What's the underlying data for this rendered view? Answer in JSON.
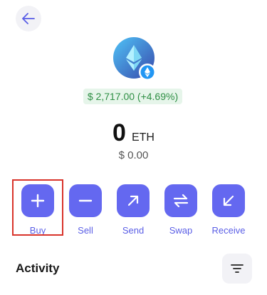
{
  "header": {
    "back_icon": "arrow-left-icon"
  },
  "token": {
    "logo_icon": "ethereum-icon",
    "badge_icon": "network-badge-icon",
    "price_change": "$ 2,717.00 (+4.69%)",
    "balance_amount": "0",
    "balance_symbol": "ETH",
    "fiat_value": "$ 0.00"
  },
  "actions": [
    {
      "label": "Buy",
      "icon": "plus-icon"
    },
    {
      "label": "Sell",
      "icon": "minus-icon"
    },
    {
      "label": "Send",
      "icon": "arrow-up-right-icon"
    },
    {
      "label": "Swap",
      "icon": "swap-arrows-icon"
    },
    {
      "label": "Receive",
      "icon": "arrow-down-left-icon"
    }
  ],
  "activity": {
    "title": "Activity",
    "filter_icon": "filter-icon"
  },
  "colors": {
    "accent": "#6468f0",
    "positive": "#2f8f45",
    "positive_bg": "#e6f5ea",
    "highlight": "#d9342b"
  }
}
